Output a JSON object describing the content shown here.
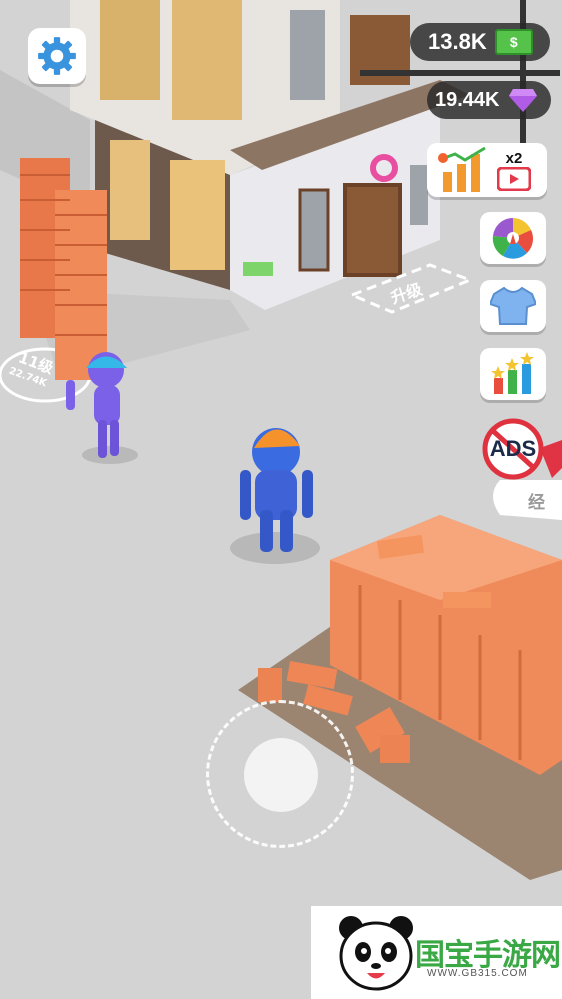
{
  "hud": {
    "cash": "13.8K",
    "gems": "19.44K",
    "boost_multiplier": "x2",
    "ads_label": "ADS"
  },
  "floor": {
    "level_tag": "11级",
    "level_cost": "22.74K",
    "upgrade_tag": "升级",
    "manager_tag": "经"
  },
  "watermark": {
    "brand": "国宝手游网",
    "url": "WWW.GB315.COM"
  },
  "icons": [
    "gear-icon",
    "cash-icon",
    "gem-icon",
    "chart-boost-icon",
    "video-icon",
    "spin-wheel-icon",
    "tshirt-icon",
    "stats-bars-icon",
    "no-ads-icon",
    "joystick-icon",
    "panda-logo-icon"
  ]
}
